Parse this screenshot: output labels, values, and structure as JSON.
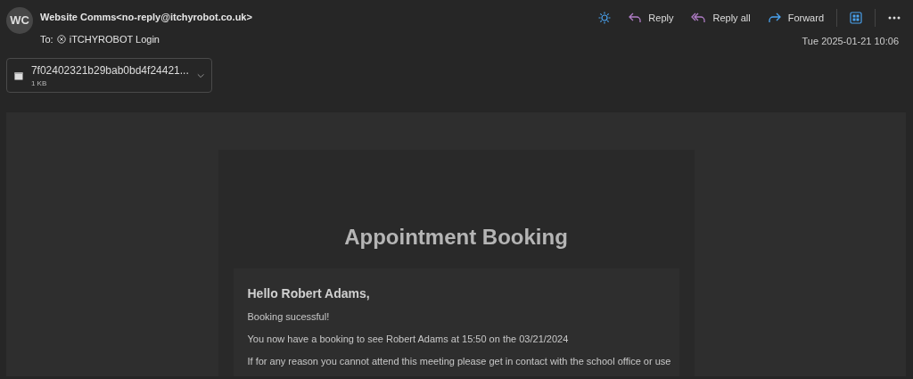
{
  "sender": {
    "initials": "WC",
    "from": "Website Comms<no-reply@itchyrobot.co.uk>",
    "to_label": "To:",
    "to": "iTCHYROBOT Login"
  },
  "actions": [
    {
      "kind": "theme"
    },
    {
      "kind": "reply",
      "label": "Reply"
    },
    {
      "kind": "reply_all",
      "label": "Reply all"
    },
    {
      "kind": "forward",
      "label": "Forward"
    },
    {
      "kind": "apps"
    },
    {
      "kind": "more"
    }
  ],
  "date": "Tue 2025-01-21 10:06",
  "attachment": {
    "name": "7f02402321b29bab0bd4f24421...",
    "size": "1 KB"
  },
  "email": {
    "title": "Appointment Booking",
    "greeting": "Hello Robert Adams,",
    "paragraphs": [
      "Booking sucessful!",
      "You now have a booking to see Robert Adams at 15:50 on the 03/21/2024",
      "If for any reason you cannot attend this meeting please get in contact with the school office or use"
    ]
  }
}
